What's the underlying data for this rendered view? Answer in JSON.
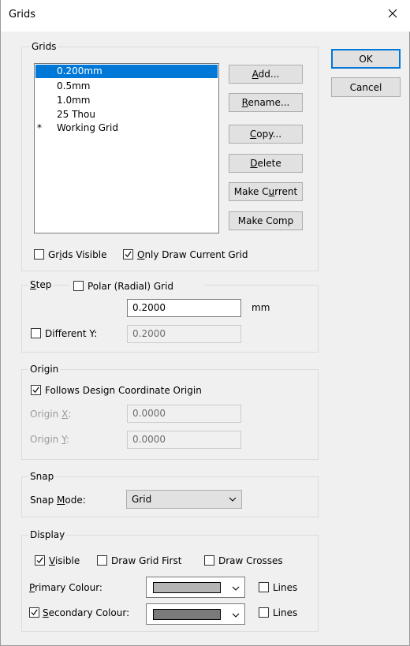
{
  "window": {
    "title": "Grids",
    "close_icon": "close-icon"
  },
  "buttons": {
    "ok": "OK",
    "cancel": "Cancel",
    "add_pre": "",
    "add_u": "A",
    "add_post": "dd...",
    "rename_pre": "",
    "rename_u": "R",
    "rename_post": "ename...",
    "copy_pre": "",
    "copy_u": "C",
    "copy_post": "opy...",
    "delete_pre": "",
    "delete_u": "D",
    "delete_post": "elete",
    "make_current_pre": "Make C",
    "make_current_u": "u",
    "make_current_post": "rrent",
    "make_comp": "Make Comp"
  },
  "grids_group": {
    "title": "Grids",
    "items": [
      {
        "mark": "",
        "label": "0.200mm",
        "selected": true
      },
      {
        "mark": "",
        "label": "0.5mm",
        "selected": false
      },
      {
        "mark": "",
        "label": "1.0mm",
        "selected": false
      },
      {
        "mark": "",
        "label": "25 Thou",
        "selected": false
      },
      {
        "mark": "*",
        "label": "Working Grid",
        "selected": false
      }
    ],
    "grids_visible_pre": "Gr",
    "grids_visible_u": "i",
    "grids_visible_post": "ds Visible",
    "grids_visible_checked": false,
    "only_draw_pre": "",
    "only_draw_u": "O",
    "only_draw_post": "nly Draw Current Grid",
    "only_draw_checked": true
  },
  "step_group": {
    "title_u": "S",
    "title_post": "tep",
    "polar_label": "Polar (Radial) Grid",
    "polar_checked": false,
    "step_value": "0.2000",
    "unit": "mm",
    "different_y_label": "Different Y:",
    "different_y_checked": false,
    "different_y_value": "0.2000"
  },
  "origin_group": {
    "title": "Origin",
    "follows_label": "Follows Design Coordinate Origin",
    "follows_checked": true,
    "origin_x_pre": "Origin ",
    "origin_x_u": "X",
    "origin_x_post": ":",
    "origin_x_value": "0.0000",
    "origin_y_pre": "Origin ",
    "origin_y_u": "Y",
    "origin_y_post": ":",
    "origin_y_value": "0.0000"
  },
  "snap_group": {
    "title": "Snap",
    "snap_mode_pre": "Snap ",
    "snap_mode_u": "M",
    "snap_mode_post": "ode:",
    "snap_mode_value": "Grid"
  },
  "display_group": {
    "title": "Display",
    "visible_pre": "",
    "visible_u": "V",
    "visible_post": "isible",
    "visible_checked": true,
    "draw_grid_first": "Draw Grid First",
    "draw_grid_first_checked": false,
    "draw_crosses": "Draw Crosses",
    "draw_crosses_checked": false,
    "primary_pre": "",
    "primary_u": "P",
    "primary_post": "rimary Colour:",
    "primary_color": "#b4b4b4",
    "primary_lines": "Lines",
    "primary_lines_checked": false,
    "secondary_pre": "",
    "secondary_u": "S",
    "secondary_post": "econdary Colour:",
    "secondary_checked": true,
    "secondary_color": "#7a7a7a",
    "secondary_lines": "Lines",
    "secondary_lines_checked": false
  },
  "colors": {
    "selection": "#0078d7",
    "default_button_border": "#0078d7"
  }
}
